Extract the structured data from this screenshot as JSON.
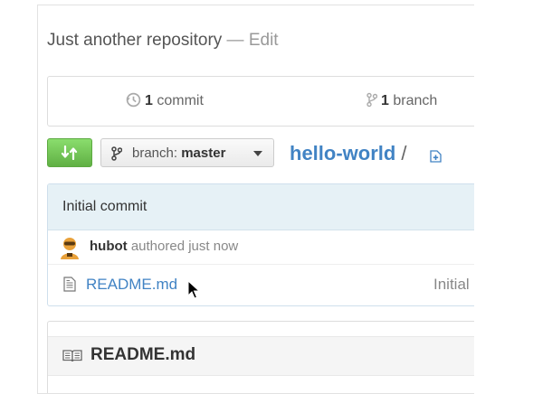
{
  "repo": {
    "description": "Just another repository",
    "dash": "—",
    "edit_label": "Edit",
    "name": "hello-world",
    "separator": "/"
  },
  "stats": {
    "commits_count": "1",
    "commits_label": "commit",
    "branches_count": "1",
    "branches_label": "branch"
  },
  "branch_select": {
    "prefix": "branch:",
    "value": "master"
  },
  "latest_commit": {
    "message": "Initial commit",
    "author": "hubot",
    "action": "authored just now"
  },
  "files": [
    {
      "name": "README.md",
      "message": "Initial"
    }
  ],
  "readme": {
    "title": "README.md"
  },
  "colors": {
    "link": "#4183c4",
    "compare_green": "#60b044",
    "commit_header_bg": "#e6f1f6"
  },
  "icons": {
    "commits": "history-icon",
    "branches": "git-branch-icon",
    "compare": "compare-icon",
    "new_file": "new-file-icon",
    "file": "file-text-icon",
    "readme": "book-icon"
  }
}
